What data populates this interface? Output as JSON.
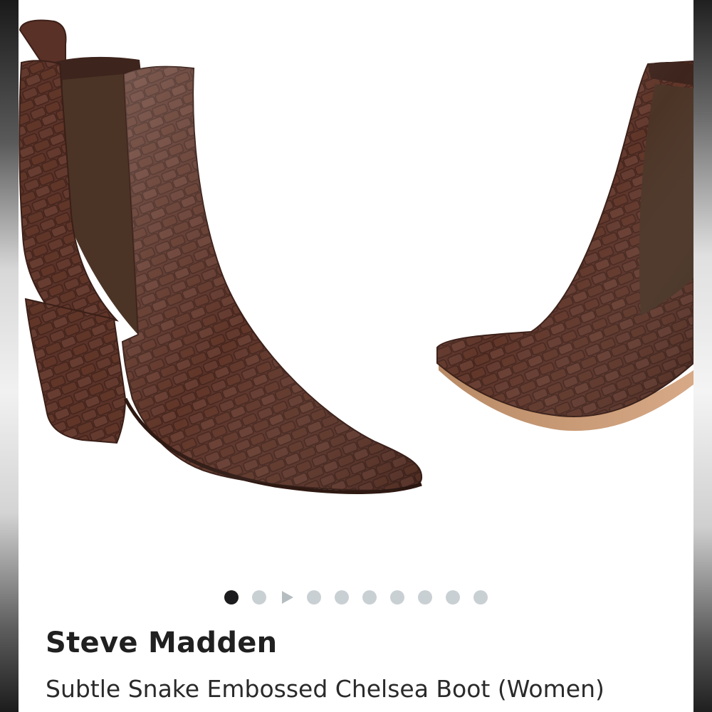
{
  "product": {
    "brand": "Steve Madden",
    "title": "Subtle Snake Embossed Chelsea Boot (Women)"
  },
  "carousel": {
    "total_images": 9,
    "active_index": 0,
    "has_video": true
  },
  "colors": {
    "boot_leather": "#5a3127",
    "boot_elastic": "#4a3526",
    "active_dot": "#1c1c1e",
    "inactive_dot": "#c9d0d3"
  }
}
